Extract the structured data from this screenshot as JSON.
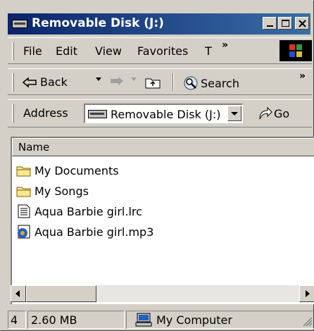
{
  "window": {
    "title": "Removable Disk (J:)"
  },
  "menu": {
    "items": [
      "File",
      "Edit",
      "View",
      "Favorites",
      "T"
    ],
    "overflow": "»"
  },
  "toolbar": {
    "back_label": "Back",
    "search_label": "Search",
    "overflow": "»"
  },
  "address": {
    "label": "Address",
    "value": "Removable Disk (J:)",
    "go_label": "Go"
  },
  "list": {
    "column_header": "Name",
    "items": [
      {
        "name": "My Documents",
        "icon": "folder-icon"
      },
      {
        "name": "My Songs",
        "icon": "folder-icon"
      },
      {
        "name": "Aqua  Barbie girl.lrc",
        "icon": "text-file-icon"
      },
      {
        "name": "Aqua  Barbie girl.mp3",
        "icon": "media-file-icon"
      }
    ]
  },
  "status": {
    "count": "4",
    "size": "2.60 MB",
    "zone": "My Computer"
  },
  "colors": {
    "titlebar_start": "#0a246a",
    "titlebar_end": "#3a6ea5",
    "face": "#d4d0c8"
  }
}
